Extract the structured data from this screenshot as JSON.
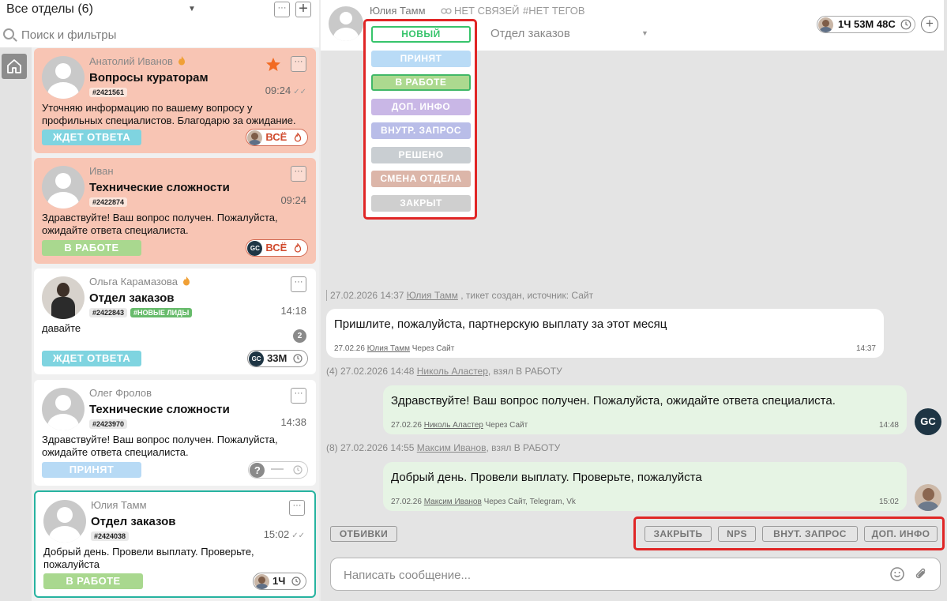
{
  "sidebar": {
    "department_selector": "Все отделы (6)",
    "search_placeholder": "Поиск и фильтры",
    "more_label": "···",
    "add_label": "+"
  },
  "tickets": [
    {
      "sender": "Анатолий Иванов",
      "subject": "Вопросы кураторам",
      "ticket_id": "#2421561",
      "time": "09:24",
      "preview": "Уточняю информацию по вашему вопросу у профильных специалистов. Благодарю за ожидание.",
      "status": "ЖДЕТ ОТВЕТА",
      "assignee": "ВСЁ"
    },
    {
      "sender": "Иван",
      "subject": "Технические сложности",
      "ticket_id": "#2422874",
      "time": "09:24",
      "preview": "Здравствуйте! Ваш вопрос получен. Пожалуйста, ожидайте ответа специалиста.",
      "status": "В РАБОТЕ",
      "assignee": "ВСЁ",
      "assignee_avatar": "GC"
    },
    {
      "sender": "Ольга Карамазова",
      "subject": "Отдел заказов",
      "ticket_id": "#2422843",
      "tag": "#НОВЫЕ ЛИДЫ",
      "time": "14:18",
      "preview": "давайте",
      "unread": "2",
      "status": "ЖДЕТ ОТВЕТА",
      "assignee": "33М",
      "assignee_avatar": "GC"
    },
    {
      "sender": "Олег Фролов",
      "subject": "Технические сложности",
      "ticket_id": "#2423970",
      "time": "14:38",
      "preview": "Здравствуйте! Ваш вопрос получен. Пожалуйста, ожидайте ответа специалиста.",
      "status": "ПРИНЯТ",
      "assignee_avatar": "?"
    },
    {
      "sender": "Юлия Тамм",
      "subject": "Отдел заказов",
      "ticket_id": "#2424038",
      "time": "15:02",
      "preview": "Добрый день. Провели выплату. Проверьте, пожалуйста",
      "status": "В РАБОТЕ",
      "assignee": "1Ч"
    }
  ],
  "chat_header": {
    "name": "Юлия Тамм",
    "links": "НЕТ СВЯЗЕЙ",
    "tags": "#НЕТ ТЕГОВ",
    "department": "Отдел заказов",
    "timer": "1Ч 53М 48С",
    "add_label": "+"
  },
  "status_menu": [
    "НОВЫЙ",
    "ПРИНЯТ",
    "В РАБОТЕ",
    "ДОП. ИНФО",
    "ВНУТР. ЗАПРОС",
    "РЕШЕНО",
    "СМЕНА ОТДЕЛА",
    "ЗАКРЫТ"
  ],
  "messages": {
    "sys1": {
      "prefix": "27.02.2026 14:37",
      "user": "Юлия Тамм",
      "suffix": ", тикет создан, источник: Сайт"
    },
    "m1": {
      "text": "Пришлите, пожалуйста, партнерскую выплату за этот месяц",
      "date": "27.02.26",
      "user": "Юлия Тамм",
      "via": "Через Сайт",
      "time": "14:37"
    },
    "sys2": {
      "prefix": "(4) 27.02.2026 14:48",
      "user": "Николь Аластер",
      "suffix": ", взял В РАБОТУ"
    },
    "m2": {
      "text": "Здравствуйте! Ваш вопрос получен. Пожалуйста, ожидайте ответа специалиста.",
      "date": "27.02.26",
      "user": "Николь Аластер",
      "via": "Через Сайт",
      "time": "14:48",
      "avatar": "GC"
    },
    "sys3": {
      "prefix": "(8) 27.02.2026 14:55",
      "user": "Максим Иванов",
      "suffix": ", взял В РАБОТУ"
    },
    "m3": {
      "text": "Добрый день. Провели выплату. Проверьте, пожалуйста",
      "date": "27.02.26",
      "user": "Максим Иванов",
      "via": "Через Сайт, Telegram, Vk",
      "time": "15:02"
    }
  },
  "quick_buttons": {
    "templates": "ОТБИВКИ",
    "close": "ЗАКРЫТЬ",
    "nps": "NPS",
    "internal": "ВНУТ. ЗАПРОС",
    "info": "ДОП. ИНФО"
  },
  "composer": {
    "placeholder": "Написать сообщение..."
  },
  "colors": {
    "accent_teal": "#27b3a0",
    "highlight_red": "#e02626",
    "card_pink": "#f8c5b4",
    "status_wait": "#7fd4e0",
    "status_work": "#a9d88f",
    "status_accept": "#b7daf5"
  }
}
